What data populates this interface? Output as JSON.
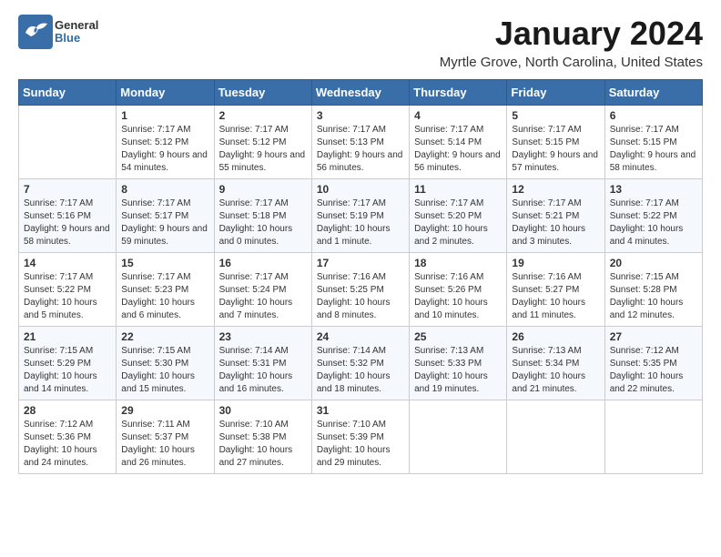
{
  "header": {
    "logo_general": "General",
    "logo_blue": "Blue",
    "month_title": "January 2024",
    "location": "Myrtle Grove, North Carolina, United States"
  },
  "calendar": {
    "days_of_week": [
      "Sunday",
      "Monday",
      "Tuesday",
      "Wednesday",
      "Thursday",
      "Friday",
      "Saturday"
    ],
    "weeks": [
      [
        {
          "day": "",
          "sunrise": "",
          "sunset": "",
          "daylight": ""
        },
        {
          "day": "1",
          "sunrise": "Sunrise: 7:17 AM",
          "sunset": "Sunset: 5:12 PM",
          "daylight": "Daylight: 9 hours and 54 minutes."
        },
        {
          "day": "2",
          "sunrise": "Sunrise: 7:17 AM",
          "sunset": "Sunset: 5:12 PM",
          "daylight": "Daylight: 9 hours and 55 minutes."
        },
        {
          "day": "3",
          "sunrise": "Sunrise: 7:17 AM",
          "sunset": "Sunset: 5:13 PM",
          "daylight": "Daylight: 9 hours and 56 minutes."
        },
        {
          "day": "4",
          "sunrise": "Sunrise: 7:17 AM",
          "sunset": "Sunset: 5:14 PM",
          "daylight": "Daylight: 9 hours and 56 minutes."
        },
        {
          "day": "5",
          "sunrise": "Sunrise: 7:17 AM",
          "sunset": "Sunset: 5:15 PM",
          "daylight": "Daylight: 9 hours and 57 minutes."
        },
        {
          "day": "6",
          "sunrise": "Sunrise: 7:17 AM",
          "sunset": "Sunset: 5:15 PM",
          "daylight": "Daylight: 9 hours and 58 minutes."
        }
      ],
      [
        {
          "day": "7",
          "sunrise": "Sunrise: 7:17 AM",
          "sunset": "Sunset: 5:16 PM",
          "daylight": "Daylight: 9 hours and 58 minutes."
        },
        {
          "day": "8",
          "sunrise": "Sunrise: 7:17 AM",
          "sunset": "Sunset: 5:17 PM",
          "daylight": "Daylight: 9 hours and 59 minutes."
        },
        {
          "day": "9",
          "sunrise": "Sunrise: 7:17 AM",
          "sunset": "Sunset: 5:18 PM",
          "daylight": "Daylight: 10 hours and 0 minutes."
        },
        {
          "day": "10",
          "sunrise": "Sunrise: 7:17 AM",
          "sunset": "Sunset: 5:19 PM",
          "daylight": "Daylight: 10 hours and 1 minute."
        },
        {
          "day": "11",
          "sunrise": "Sunrise: 7:17 AM",
          "sunset": "Sunset: 5:20 PM",
          "daylight": "Daylight: 10 hours and 2 minutes."
        },
        {
          "day": "12",
          "sunrise": "Sunrise: 7:17 AM",
          "sunset": "Sunset: 5:21 PM",
          "daylight": "Daylight: 10 hours and 3 minutes."
        },
        {
          "day": "13",
          "sunrise": "Sunrise: 7:17 AM",
          "sunset": "Sunset: 5:22 PM",
          "daylight": "Daylight: 10 hours and 4 minutes."
        }
      ],
      [
        {
          "day": "14",
          "sunrise": "Sunrise: 7:17 AM",
          "sunset": "Sunset: 5:22 PM",
          "daylight": "Daylight: 10 hours and 5 minutes."
        },
        {
          "day": "15",
          "sunrise": "Sunrise: 7:17 AM",
          "sunset": "Sunset: 5:23 PM",
          "daylight": "Daylight: 10 hours and 6 minutes."
        },
        {
          "day": "16",
          "sunrise": "Sunrise: 7:17 AM",
          "sunset": "Sunset: 5:24 PM",
          "daylight": "Daylight: 10 hours and 7 minutes."
        },
        {
          "day": "17",
          "sunrise": "Sunrise: 7:16 AM",
          "sunset": "Sunset: 5:25 PM",
          "daylight": "Daylight: 10 hours and 8 minutes."
        },
        {
          "day": "18",
          "sunrise": "Sunrise: 7:16 AM",
          "sunset": "Sunset: 5:26 PM",
          "daylight": "Daylight: 10 hours and 10 minutes."
        },
        {
          "day": "19",
          "sunrise": "Sunrise: 7:16 AM",
          "sunset": "Sunset: 5:27 PM",
          "daylight": "Daylight: 10 hours and 11 minutes."
        },
        {
          "day": "20",
          "sunrise": "Sunrise: 7:15 AM",
          "sunset": "Sunset: 5:28 PM",
          "daylight": "Daylight: 10 hours and 12 minutes."
        }
      ],
      [
        {
          "day": "21",
          "sunrise": "Sunrise: 7:15 AM",
          "sunset": "Sunset: 5:29 PM",
          "daylight": "Daylight: 10 hours and 14 minutes."
        },
        {
          "day": "22",
          "sunrise": "Sunrise: 7:15 AM",
          "sunset": "Sunset: 5:30 PM",
          "daylight": "Daylight: 10 hours and 15 minutes."
        },
        {
          "day": "23",
          "sunrise": "Sunrise: 7:14 AM",
          "sunset": "Sunset: 5:31 PM",
          "daylight": "Daylight: 10 hours and 16 minutes."
        },
        {
          "day": "24",
          "sunrise": "Sunrise: 7:14 AM",
          "sunset": "Sunset: 5:32 PM",
          "daylight": "Daylight: 10 hours and 18 minutes."
        },
        {
          "day": "25",
          "sunrise": "Sunrise: 7:13 AM",
          "sunset": "Sunset: 5:33 PM",
          "daylight": "Daylight: 10 hours and 19 minutes."
        },
        {
          "day": "26",
          "sunrise": "Sunrise: 7:13 AM",
          "sunset": "Sunset: 5:34 PM",
          "daylight": "Daylight: 10 hours and 21 minutes."
        },
        {
          "day": "27",
          "sunrise": "Sunrise: 7:12 AM",
          "sunset": "Sunset: 5:35 PM",
          "daylight": "Daylight: 10 hours and 22 minutes."
        }
      ],
      [
        {
          "day": "28",
          "sunrise": "Sunrise: 7:12 AM",
          "sunset": "Sunset: 5:36 PM",
          "daylight": "Daylight: 10 hours and 24 minutes."
        },
        {
          "day": "29",
          "sunrise": "Sunrise: 7:11 AM",
          "sunset": "Sunset: 5:37 PM",
          "daylight": "Daylight: 10 hours and 26 minutes."
        },
        {
          "day": "30",
          "sunrise": "Sunrise: 7:10 AM",
          "sunset": "Sunset: 5:38 PM",
          "daylight": "Daylight: 10 hours and 27 minutes."
        },
        {
          "day": "31",
          "sunrise": "Sunrise: 7:10 AM",
          "sunset": "Sunset: 5:39 PM",
          "daylight": "Daylight: 10 hours and 29 minutes."
        },
        {
          "day": "",
          "sunrise": "",
          "sunset": "",
          "daylight": ""
        },
        {
          "day": "",
          "sunrise": "",
          "sunset": "",
          "daylight": ""
        },
        {
          "day": "",
          "sunrise": "",
          "sunset": "",
          "daylight": ""
        }
      ]
    ]
  }
}
